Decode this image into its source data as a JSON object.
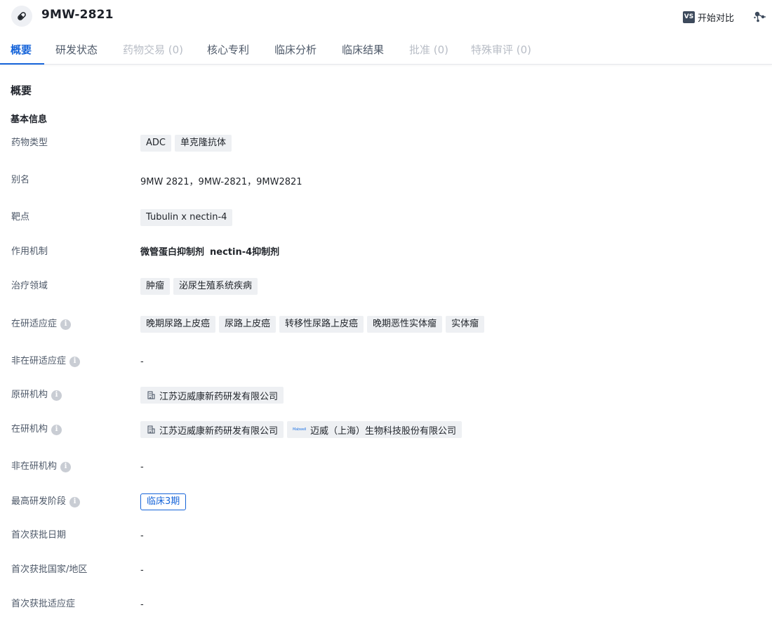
{
  "header": {
    "drug_name": "9MW-2821",
    "compare_badge": "VS",
    "compare_label": "开始对比"
  },
  "tabs": [
    {
      "label": "概要",
      "state": "active"
    },
    {
      "label": "研发状态",
      "state": "normal"
    },
    {
      "label": "药物交易 (0)",
      "state": "disabled"
    },
    {
      "label": "核心专利",
      "state": "normal"
    },
    {
      "label": "临床分析",
      "state": "normal"
    },
    {
      "label": "临床结果",
      "state": "normal"
    },
    {
      "label": "批准 (0)",
      "state": "disabled"
    },
    {
      "label": "特殊审评 (0)",
      "state": "disabled"
    }
  ],
  "content": {
    "section_title": "概要",
    "subsection_title": "基本信息",
    "rows": {
      "drug_type": {
        "label": "药物类型",
        "tags": [
          "ADC",
          "单克隆抗体"
        ]
      },
      "alias": {
        "label": "别名",
        "text": "9MW 2821，9MW-2821，9MW2821"
      },
      "target": {
        "label": "靶点",
        "tags": [
          "Tubulin x nectin-4"
        ]
      },
      "mechanism": {
        "label": "作用机制",
        "items": [
          "微管蛋白抑制剂",
          "nectin-4抑制剂"
        ]
      },
      "therapeutic_area": {
        "label": "治疗领域",
        "tags": [
          "肿瘤",
          "泌尿生殖系统疾病"
        ]
      },
      "active_indications": {
        "label": "在研适应症",
        "tags": [
          "晚期尿路上皮癌",
          "尿路上皮癌",
          "转移性尿路上皮癌",
          "晚期恶性实体瘤",
          "实体瘤"
        ]
      },
      "inactive_indications": {
        "label": "非在研适应症",
        "text": "-"
      },
      "originator": {
        "label": "原研机构",
        "orgs": [
          {
            "name": "江苏迈威康新药研发有限公司",
            "logo": "building-icon"
          }
        ]
      },
      "active_orgs": {
        "label": "在研机构",
        "orgs": [
          {
            "name": "江苏迈威康新药研发有限公司",
            "logo": "building-icon"
          },
          {
            "name": "迈威（上海）生物科技股份有限公司",
            "logo": "mabwell-logo",
            "logo_text": "Mabwell"
          }
        ]
      },
      "inactive_orgs": {
        "label": "非在研机构",
        "text": "-"
      },
      "highest_phase": {
        "label": "最高研发阶段",
        "tag": "临床3期"
      },
      "first_approval_date": {
        "label": "首次获批日期",
        "text": "-"
      },
      "first_approval_country": {
        "label": "首次获批国家/地区",
        "text": "-"
      },
      "first_approval_indication": {
        "label": "首次获批适应症",
        "text": "-"
      }
    }
  },
  "colors": {
    "accent": "#1664d9",
    "tag_bg": "#eef0f3",
    "label": "#4e5969",
    "disabled": "#b8bdc6"
  }
}
